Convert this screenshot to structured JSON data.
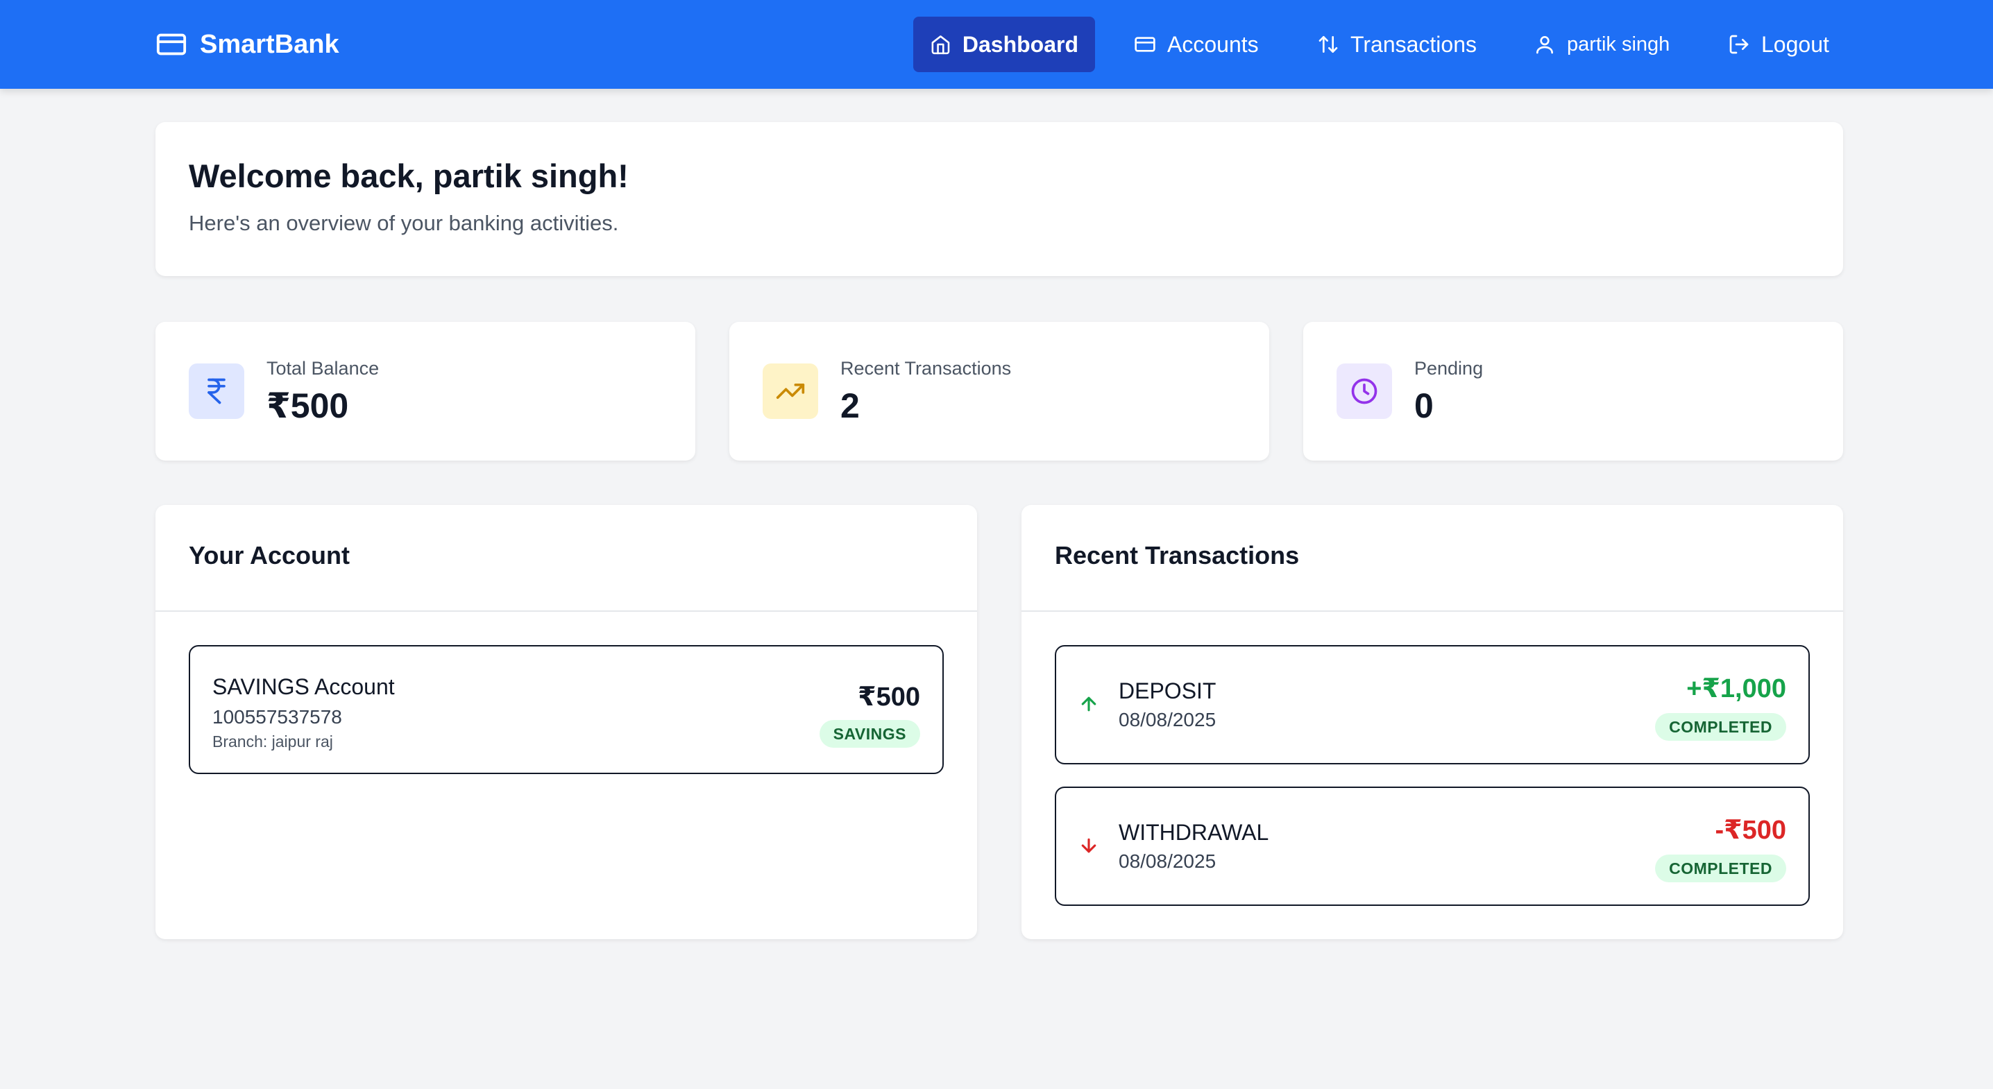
{
  "brand": {
    "name": "SmartBank",
    "icon": "credit-card-icon"
  },
  "nav": {
    "dashboard": {
      "label": "Dashboard",
      "icon": "home-icon"
    },
    "accounts": {
      "label": "Accounts",
      "icon": "credit-card-icon"
    },
    "transactions": {
      "label": "Transactions",
      "icon": "arrows-up-down-icon"
    },
    "user": {
      "label": "partik singh",
      "icon": "user-icon"
    },
    "logout": {
      "label": "Logout",
      "icon": "logout-icon"
    }
  },
  "welcome": {
    "title": "Welcome back, partik singh!",
    "subtitle": "Here's an overview of your banking activities."
  },
  "stats": [
    {
      "label": "Total Balance",
      "value": "₹500",
      "icon": "rupee-icon",
      "color": "#2563eb",
      "bg": "#e0e7ff"
    },
    {
      "label": "Recent Transactions",
      "value": "2",
      "icon": "trending-up-icon",
      "color": "#ca8a04",
      "bg": "#fef3c7"
    },
    {
      "label": "Pending",
      "value": "0",
      "icon": "clock-icon",
      "color": "#9333ea",
      "bg": "#ede9fe"
    }
  ],
  "account_panel": {
    "title": "Your Account",
    "account": {
      "name": "SAVINGS Account",
      "number": "100557537578",
      "branch": "Branch: jaipur raj",
      "balance": "₹500",
      "type_badge": "SAVINGS"
    }
  },
  "transactions_panel": {
    "title": "Recent Transactions",
    "items": [
      {
        "type": "DEPOSIT",
        "date": "08/08/2025",
        "amount": "+₹1,000",
        "status": "COMPLETED",
        "icon": "arrow-up-icon",
        "color": "#16a34a"
      },
      {
        "type": "WITHDRAWAL",
        "date": "08/08/2025",
        "amount": "-₹500",
        "status": "COMPLETED",
        "icon": "arrow-down-icon",
        "color": "#dc2626"
      }
    ]
  },
  "colors": {
    "primary": "#1e6ff5",
    "active_nav": "#1e3fb8",
    "success": "#16a34a",
    "danger": "#dc2626"
  }
}
